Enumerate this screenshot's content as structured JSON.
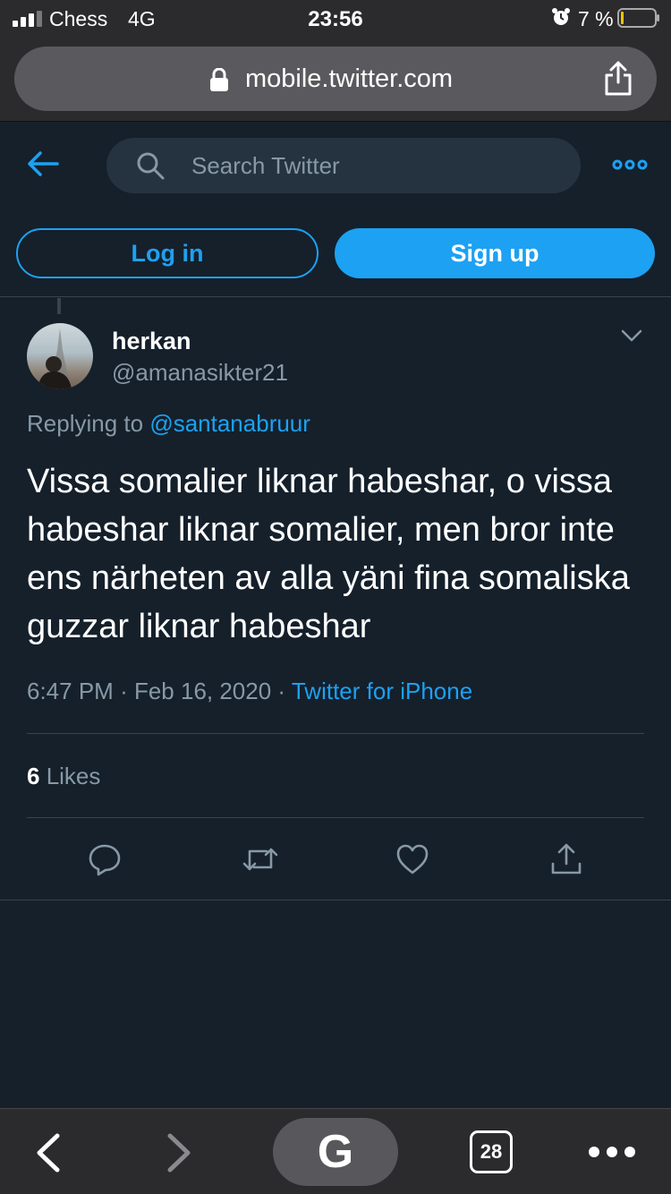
{
  "status_bar": {
    "carrier": "Chess",
    "network": "4G",
    "time": "23:56",
    "battery_percent": "7 %"
  },
  "browser": {
    "url": "mobile.twitter.com",
    "open_tabs": "28",
    "google_label": "G"
  },
  "header": {
    "search_placeholder": "Search Twitter"
  },
  "auth": {
    "login_label": "Log in",
    "signup_label": "Sign up"
  },
  "tweet": {
    "display_name": "herkan",
    "handle": "@amanasikter21",
    "replying_prefix": "Replying to ",
    "replying_to": "@santanabruur",
    "text": "Vissa somalier liknar habeshar, o vissa habeshar liknar somalier, men bror inte ens närheten av alla yäni fina somaliska guzzar liknar habeshar",
    "time": "6:47 PM",
    "date": "Feb 16, 2020",
    "source": "Twitter for iPhone",
    "likes_count": "6",
    "likes_label": " Likes"
  },
  "colors": {
    "background": "#15202b",
    "accent": "#1da1f2",
    "muted_text": "#8899a6",
    "divider": "#38444d",
    "browser_chrome": "#2b2b2d"
  },
  "icons": {
    "back": "arrow-left-icon",
    "search": "search-icon",
    "more": "more-dots-icon",
    "reply": "reply-bubble-icon",
    "retweet": "retweet-icon",
    "like": "heart-icon",
    "share": "share-icon"
  }
}
